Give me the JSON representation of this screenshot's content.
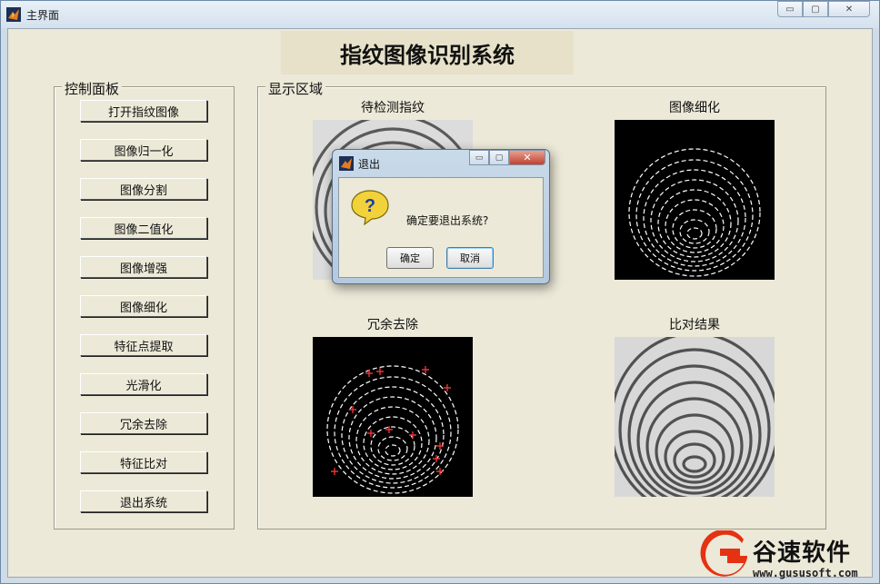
{
  "window": {
    "title": "主界面",
    "controls": {
      "minimize": "▭",
      "maximize": "▢",
      "close": "✕"
    }
  },
  "banner": {
    "title": "指纹图像识别系统"
  },
  "control_panel": {
    "title": "控制面板",
    "buttons": [
      "打开指纹图像",
      "图像归一化",
      "图像分割",
      "图像二值化",
      "图像增强",
      "图像细化",
      "特征点提取",
      "光滑化",
      "冗余去除",
      "特征比对",
      "退出系统"
    ]
  },
  "display_panel": {
    "title": "显示区域",
    "images": [
      {
        "label": "待检测指纹",
        "kind": "gray-fingerprint"
      },
      {
        "label": "图像细化",
        "kind": "thinned-fingerprint"
      },
      {
        "label": "冗余去除",
        "kind": "minutiae-fingerprint"
      },
      {
        "label": "比对结果",
        "kind": "gray-fingerprint"
      }
    ]
  },
  "dialog": {
    "title": "退出",
    "message": "确定要退出系统?",
    "icon": "question-icon",
    "ok": "确定",
    "cancel": "取消",
    "close_glyph": "✕",
    "min_glyph": "▭",
    "max_glyph": "▢"
  },
  "watermark": {
    "brand": "谷速软件",
    "url": "www.gususoft.com"
  },
  "colors": {
    "accent_red": "#e53212",
    "panel_bg": "#ece9d8",
    "minutiae": "#e53535"
  }
}
